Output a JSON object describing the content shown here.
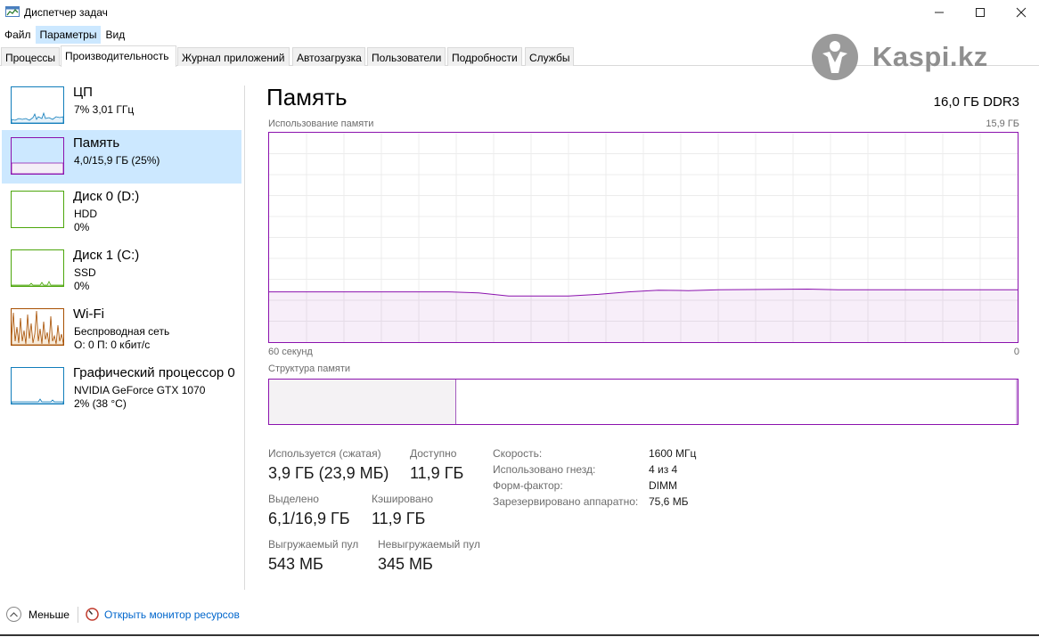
{
  "window": {
    "title": "Диспетчер задач",
    "minimize_glyph": "—",
    "maximize_glyph": "☐",
    "close_glyph": "✕"
  },
  "menu": [
    "Файл",
    "Параметры",
    "Вид"
  ],
  "menu_active": "Параметры",
  "tabs": [
    "Процессы",
    "Производительность",
    "Журнал приложений",
    "Автозагрузка",
    "Пользователи",
    "Подробности",
    "Службы"
  ],
  "tab_active": "Производительность",
  "logo": {
    "text": "Kaspi.kz"
  },
  "sidebar": [
    {
      "title": "ЦП",
      "sub1": "7% 3,01 ГГц",
      "sub2": "",
      "color": "#117dbb"
    },
    {
      "title": "Память",
      "sub1": "4,0/15,9 ГБ (25%)",
      "sub2": "",
      "color": "#8b12ae"
    },
    {
      "title": "Диск 0 (D:)",
      "sub1": "HDD",
      "sub2": "0%",
      "color": "#4da60c"
    },
    {
      "title": "Диск 1 (C:)",
      "sub1": "SSD",
      "sub2": "0%",
      "color": "#4da60c"
    },
    {
      "title": "Wi-Fi",
      "sub1": "Беспроводная сеть",
      "sub2": "О: 0 П: 0 кбит/с",
      "color": "#a74f01"
    },
    {
      "title": "Графический процессор 0",
      "sub1": "NVIDIA GeForce GTX 1070",
      "sub2": "2% (38 °C)",
      "color": "#117dbb"
    }
  ],
  "sidebar_active": "Память",
  "main": {
    "title": "Память",
    "spec": "16,0 ГБ DDR3",
    "usage_label": "Использование памяти",
    "usage_max": "15,9 ГБ",
    "time_left": "60 секунд",
    "time_right": "0",
    "composition_label": "Структура памяти",
    "accent": "#8b12ae"
  },
  "memory_usage": {
    "max_gb": 15.9,
    "used_fraction_series": [
      0.24,
      0.24,
      0.24,
      0.24,
      0.24,
      0.24,
      0.24,
      0.235,
      0.22,
      0.22,
      0.22,
      0.228,
      0.24,
      0.248,
      0.246,
      0.25,
      0.251,
      0.252,
      0.253,
      0.25,
      0.25,
      0.25,
      0.25,
      0.25,
      0.25,
      0.25
    ],
    "composition_used_fraction": 0.25
  },
  "stats": {
    "in_use_label": "Используется (сжатая)",
    "in_use_value": "3,9 ГБ (23,9 МБ)",
    "available_label": "Доступно",
    "available_value": "11,9 ГБ",
    "committed_label": "Выделено",
    "committed_value": "6,1/16,9 ГБ",
    "cached_label": "Кэшировано",
    "cached_value": "11,9 ГБ",
    "paged_label": "Выгружаемый пул",
    "paged_value": "543 МБ",
    "nonpaged_label": "Невыгружаемый пул",
    "nonpaged_value": "345 МБ"
  },
  "details": [
    {
      "label": "Скорость:",
      "value": "1600 МГц"
    },
    {
      "label": "Использовано гнезд:",
      "value": "4 из 4"
    },
    {
      "label": "Форм-фактор:",
      "value": "DIMM"
    },
    {
      "label": "Зарезервировано аппаратно:",
      "value": "75,6 МБ"
    }
  ],
  "footer": {
    "fewer": "Меньше",
    "resource_monitor": "Открыть монитор ресурсов"
  }
}
